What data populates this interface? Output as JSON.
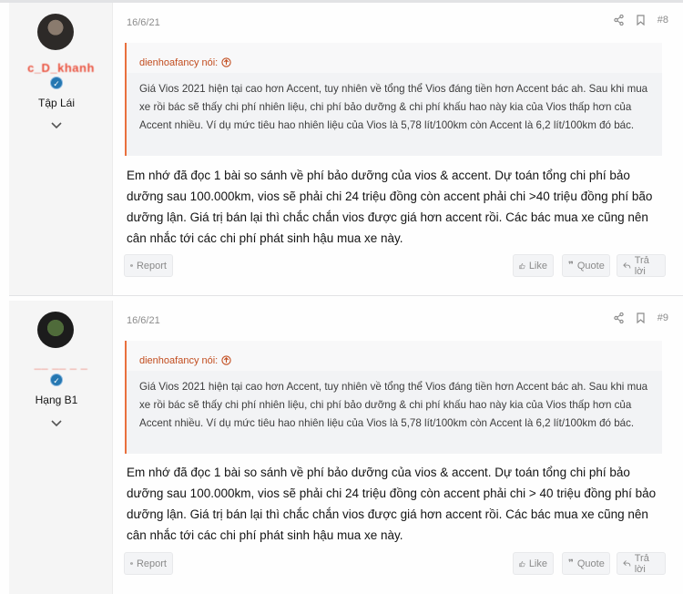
{
  "posts": [
    {
      "username": "c_D_khanh",
      "verified_badge": "✓",
      "user_title": "Tập Lái",
      "date": "16/6/21",
      "post_number": "#8",
      "quote_author": "dienhoafancy nói:",
      "quote_text": "Giá Vios 2021 hiện tại cao hơn Accent, tuy nhiên về tổng thể Vios đáng tiền hơn Accent bác ah. Sau khi mua xe rồi bác sẽ thấy chi phí nhiên liệu, chi phí bảo dưỡng & chi phí khấu hao này kia của Vios thấp hơn của Accent nhiều. Ví dụ mức tiêu hao nhiên liệu của Vios là 5,78 lít/100km còn Accent là 6,2 lít/100km đó bác.",
      "message": "Em nhớ đã đọc 1 bài so sánh về phí bảo dưỡng của vios & accent. Dự toán tổng chi phí bảo dưỡng sau 100.000km, vios sẽ phải chi 24 triệu đồng còn accent phải chi >40 triệu đồng phí bão dưỡng lận. Giá trị bán lại thì chắc chắn vios được giá hơn accent rồi. Các bác mua xe cũng nên cân nhắc tới các chi phí phát sinh hậu mua xe này."
    },
    {
      "username": "__ __ _ _",
      "verified_badge": "✓",
      "user_title": "Hạng B1",
      "date": "16/6/21",
      "post_number": "#9",
      "quote_author": "dienhoafancy nói:",
      "quote_text": "Giá Vios 2021 hiện tại cao hơn Accent, tuy nhiên về tổng thể Vios đáng tiền hơn Accent bác ah. Sau khi mua xe rồi bác sẽ thấy chi phí nhiên liệu, chi phí bảo dưỡng & chi phí khấu hao này kia của Vios thấp hơn của Accent nhiều. Ví dụ mức tiêu hao nhiên liệu của Vios là 5,78 lít/100km còn Accent là 6,2 lít/100km đó bác.",
      "message": "Em nhớ đã đọc 1 bài so sánh về phí bảo dưỡng của vios & accent. Dự toán tổng chi phí bảo dưỡng sau 100.000km, vios sẽ phải chi 24 triệu đồng còn accent phải chi > 40 triệu đồng phí bảo dưỡng lận. Giá trị bán lại thì chắc chắn vios được giá hơn accent rồi. Các bác mua xe cũng nên cân nhắc tới các chi phí phát sinh hậu mua xe này."
    }
  ],
  "buttons": {
    "report": "Report",
    "like": "Like",
    "quote": "Quote",
    "reply": "Trả lời"
  },
  "colors": {
    "quote_border": "#e9703e",
    "quote_author": "#c24d1f",
    "badge": "#2577b1",
    "username": "#e8361f"
  },
  "icons": {
    "share": "share-icon",
    "bookmark": "bookmark-icon",
    "expand": "chevron-down-icon",
    "expand_quote": "arrow-up-circle-icon",
    "report": "info-circle-icon",
    "like": "thumbs-up-icon",
    "quote": "quote-icon",
    "reply": "reply-icon"
  }
}
